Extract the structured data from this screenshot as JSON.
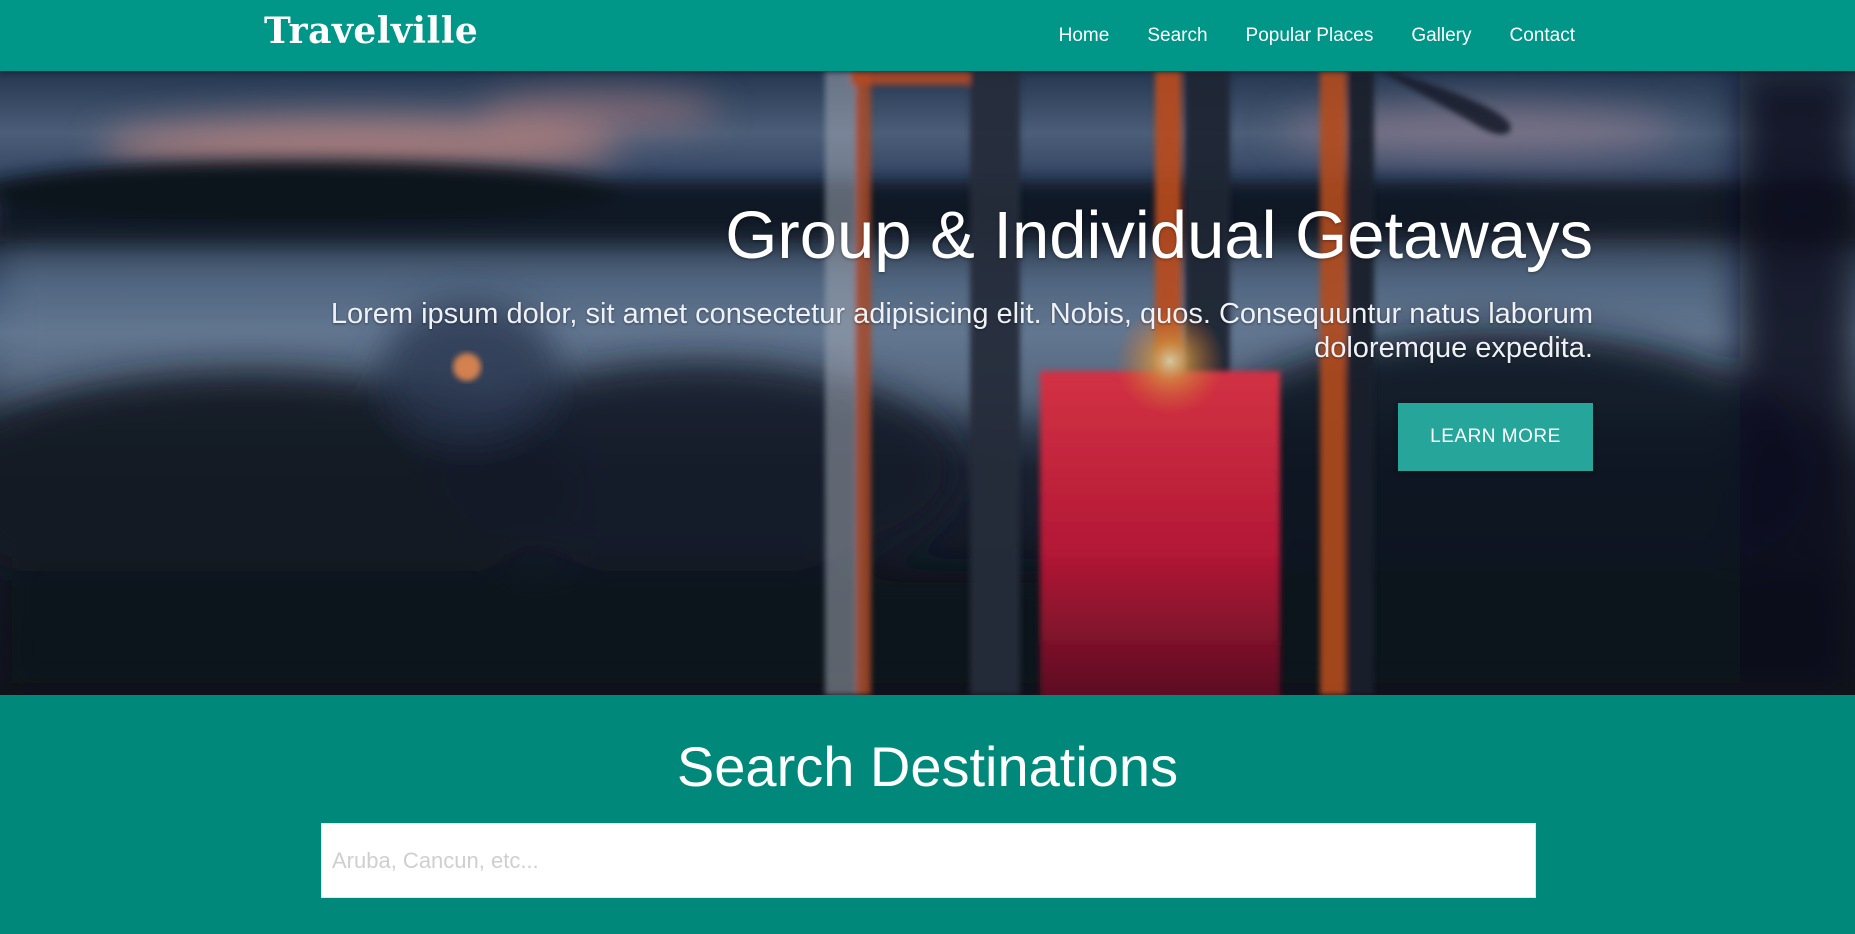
{
  "navbar": {
    "brand": "Travelville",
    "links": [
      "Home",
      "Search",
      "Popular Places",
      "Gallery",
      "Contact"
    ]
  },
  "hero": {
    "title": "Group & Individual Getaways",
    "text": "Lorem ipsum dolor, sit amet consectetur adipisicing elit. Nobis, quos. Consequuntur natus laborum doloremque expedita.",
    "button_label": "Learn More"
  },
  "search": {
    "title": "Search Destinations",
    "placeholder": "Aruba, Cancun, etc..."
  },
  "colors": {
    "navbar": "#009688",
    "section": "#00897b",
    "button": "#26a69a"
  }
}
